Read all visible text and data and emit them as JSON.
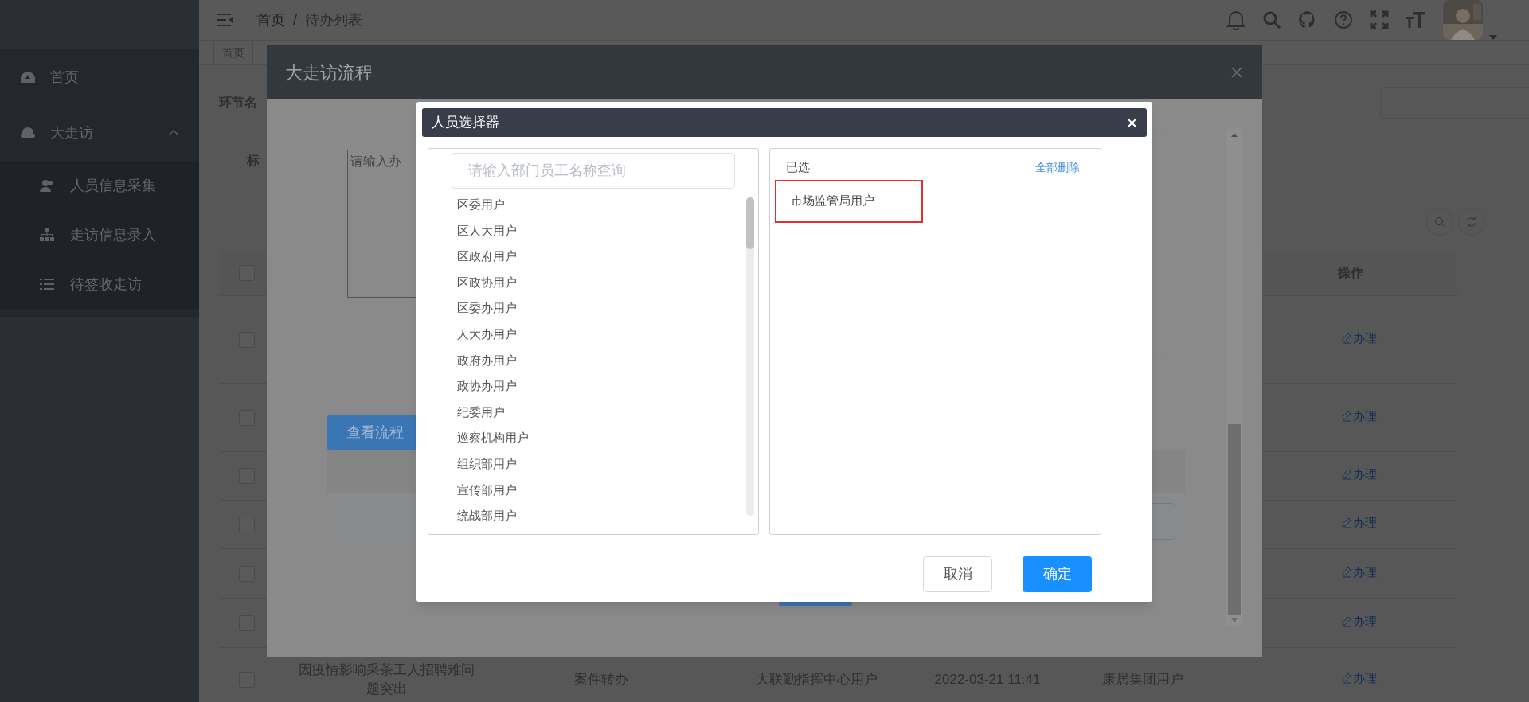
{
  "sidebar": {
    "items": [
      {
        "label": "首页"
      },
      {
        "label": "大走访",
        "expanded": true,
        "children": [
          {
            "label": "人员信息采集"
          },
          {
            "label": "走访信息录入"
          },
          {
            "label": "待签收走访"
          }
        ]
      }
    ]
  },
  "header": {
    "breadcrumb": [
      "首页",
      "待办列表"
    ],
    "separator": "/"
  },
  "tabs": [
    {
      "label": "首页",
      "selected": false
    }
  ],
  "filter": {
    "label": "环节名"
  },
  "form_label": "标",
  "table": {
    "select_all_checked": false,
    "columns": [
      {
        "label": "操作"
      }
    ],
    "rows": [
      {
        "checked": false,
        "action": "办理"
      },
      {
        "checked": false,
        "action": "办理"
      },
      {
        "checked": false,
        "action": "办理"
      },
      {
        "checked": false,
        "action": "办理"
      },
      {
        "checked": false,
        "action": "办理"
      },
      {
        "checked": false,
        "action": "办理"
      },
      {
        "checked": false,
        "title": "因疫情影响采茶工人招聘难问题突出",
        "type": "案件转办",
        "sender": "大联勤指挥中心用户",
        "time": "2022-03-21 11:41",
        "receiver": "康居集团用户",
        "action": "办理"
      }
    ]
  },
  "process_dialog": {
    "title": "大走访流程",
    "textarea_placeholder": "请输入办",
    "flow_button": "查看流程"
  },
  "picker_dialog": {
    "title": "人员选择器",
    "search_placeholder": "请输入部门员工名称查询",
    "options": [
      "区委用户",
      "区人大用户",
      "区政府用户",
      "区政协用户",
      "区委办用户",
      "人大办用户",
      "政府办用户",
      "政协办用户",
      "纪委用户",
      "巡察机构用户",
      "组织部用户",
      "宣传部用户",
      "统战部用户"
    ],
    "selected_heading": "已选",
    "clear_all": "全部删除",
    "selected": [
      "市场监管局用户"
    ],
    "cancel": "取消",
    "confirm": "确定"
  }
}
